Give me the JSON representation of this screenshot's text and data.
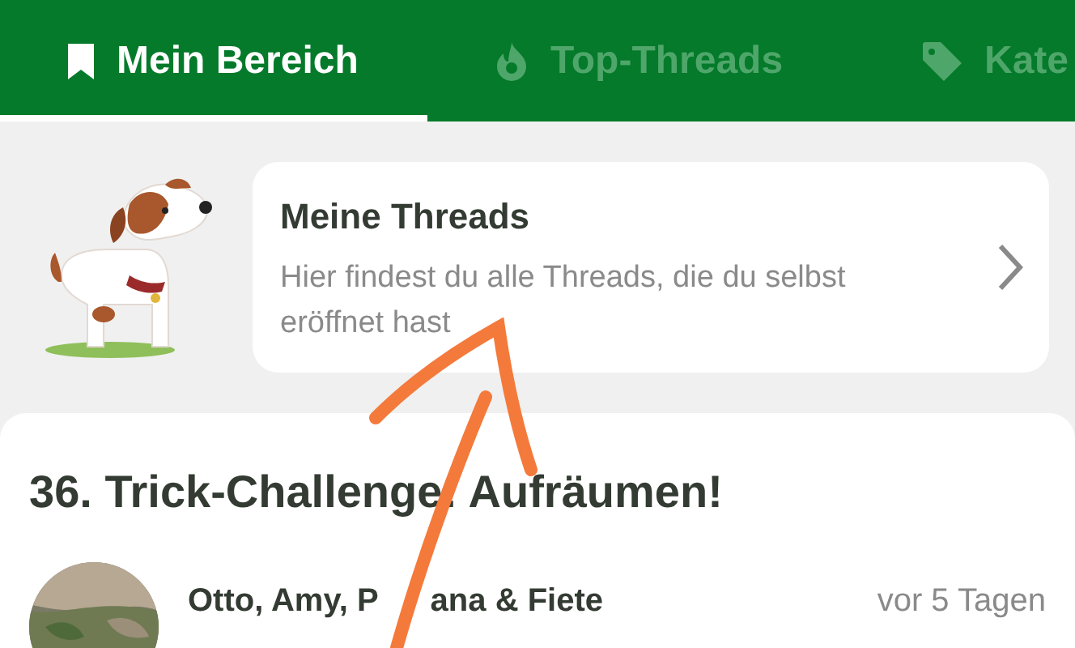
{
  "tabs": [
    {
      "label": "Mein Bereich",
      "kind": "bookmark",
      "selected": true
    },
    {
      "label": "Top-Threads",
      "kind": "flame",
      "selected": false
    },
    {
      "label": "Kate",
      "kind": "tag",
      "selected": false
    }
  ],
  "my_threads_card": {
    "title": "Meine Threads",
    "description": "Hier findest du alle Threads, die du selbst eröffnet hast"
  },
  "thread": {
    "title": "36. Trick-Challenge: Aufräumen!",
    "author_parts": [
      "Otto, Amy, P",
      "ana & Fiete"
    ],
    "time": "vor 5 Tagen",
    "avatar": {
      "kind": "picture"
    }
  }
}
